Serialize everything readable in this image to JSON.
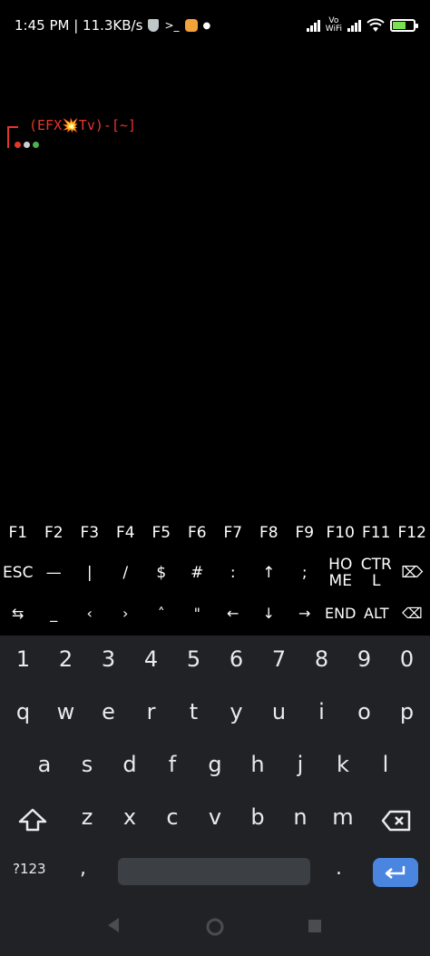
{
  "status_bar": {
    "time_speed": "1:45 PM | 11.3KB/s",
    "terminal_glyph": ">_",
    "vowifi_top": "Vo",
    "vowifi_bottom": "WiFi"
  },
  "terminal": {
    "prompt": "(EFX💥Tv)-[~]",
    "prompt_color": "#e8352c",
    "dot_colors": [
      "#e8352c",
      "#cfcfcf",
      "#4caf50"
    ]
  },
  "extra_keys": {
    "row1": [
      "F1",
      "F2",
      "F3",
      "F4",
      "F5",
      "F6",
      "F7",
      "F8",
      "F9",
      "F10",
      "F11",
      "F12"
    ],
    "row2": [
      "ESC",
      "—",
      "|",
      "/",
      "$",
      "#",
      ":",
      "↑",
      ";",
      "HO\nME",
      "CTR\nL",
      "⌦"
    ],
    "row3": [
      "⇆",
      "_",
      "‹",
      "›",
      "˄",
      "\"",
      "←",
      "↓",
      "→",
      "END",
      "ALT",
      "⌫"
    ]
  },
  "keyboard": {
    "numbers": [
      "1",
      "2",
      "3",
      "4",
      "5",
      "6",
      "7",
      "8",
      "9",
      "0"
    ],
    "row_q": [
      "q",
      "w",
      "e",
      "r",
      "t",
      "y",
      "u",
      "i",
      "o",
      "p"
    ],
    "row_a": [
      "a",
      "s",
      "d",
      "f",
      "g",
      "h",
      "j",
      "k",
      "l"
    ],
    "row_z": [
      "z",
      "x",
      "c",
      "v",
      "b",
      "n",
      "m"
    ],
    "sym_label": "?123",
    "comma": ",",
    "period": ".",
    "accent_color": "#4a86e0"
  },
  "nav_bar": {
    "back": "back-icon",
    "home": "home-icon",
    "recents": "recents-icon"
  }
}
